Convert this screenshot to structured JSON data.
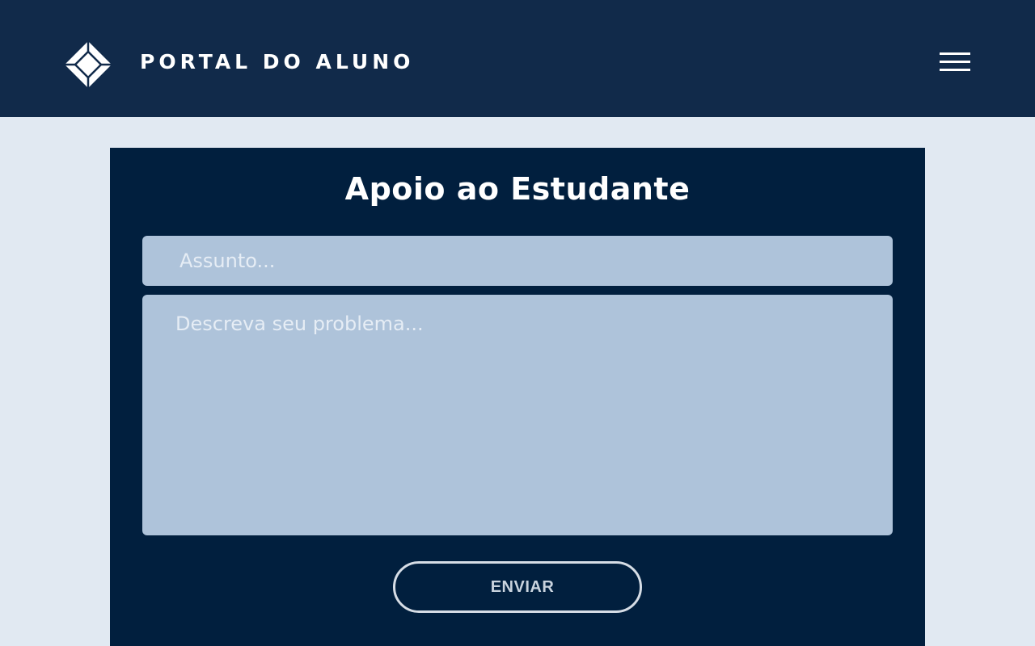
{
  "header": {
    "brand": "PORTAL DO ALUNO",
    "logo_icon": "diamond-logo-icon",
    "menu_icon": "hamburger-menu-icon"
  },
  "form": {
    "title": "Apoio ao Estudante",
    "subject": {
      "placeholder": "Assunto...",
      "value": ""
    },
    "description": {
      "placeholder": "Descreva seu problema...",
      "value": ""
    },
    "submit_label": "ENVIAR"
  },
  "colors": {
    "header_bg": "#112a4a",
    "page_bg": "#e1e9f2",
    "card_bg": "#011f3e",
    "field_bg": "#aec3da",
    "accent_text": "#ffffff"
  }
}
